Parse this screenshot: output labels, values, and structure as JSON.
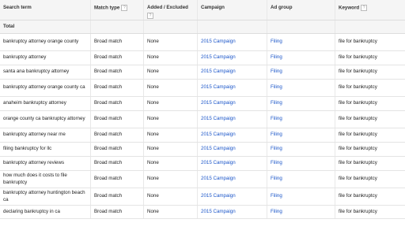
{
  "table": {
    "headers": {
      "search_term": "Search term",
      "match_type": "Match type",
      "added_excluded": "Added / Excluded",
      "campaign": "Campaign",
      "ad_group": "Ad group",
      "keyword": "Keyword"
    },
    "help_glyph": "?",
    "total_label": "Total",
    "rows": [
      {
        "search_term": "bankruptcy attorney orange county",
        "match_type": "Broad match",
        "added_excluded": "None",
        "campaign": "2015 Campaign",
        "ad_group": "Filing",
        "keyword": "file for bankruptcy"
      },
      {
        "search_term": "bankruptcy attorney",
        "match_type": "Broad match",
        "added_excluded": "None",
        "campaign": "2015 Campaign",
        "ad_group": "Filing",
        "keyword": "file for bankruptcy"
      },
      {
        "search_term": "santa ana bankruptcy attorney",
        "match_type": "Broad match",
        "added_excluded": "None",
        "campaign": "2015 Campaign",
        "ad_group": "Filing",
        "keyword": "file for bankruptcy"
      },
      {
        "search_term": "bankruptcy attorney orange county ca",
        "match_type": "Broad match",
        "added_excluded": "None",
        "campaign": "2015 Campaign",
        "ad_group": "Filing",
        "keyword": "file for bankruptcy"
      },
      {
        "search_term": "anaheim bankruptcy attorney",
        "match_type": "Broad match",
        "added_excluded": "None",
        "campaign": "2015 Campaign",
        "ad_group": "Filing",
        "keyword": "file for bankruptcy"
      },
      {
        "search_term": "orange county ca bankruptcy attorney",
        "match_type": "Broad match",
        "added_excluded": "None",
        "campaign": "2015 Campaign",
        "ad_group": "Filing",
        "keyword": "file for bankruptcy"
      },
      {
        "search_term": "bankruptcy attorney near me",
        "match_type": "Broad match",
        "added_excluded": "None",
        "campaign": "2015 Campaign",
        "ad_group": "Filing",
        "keyword": "file for bankruptcy"
      },
      {
        "search_term": "filing bankruptcy for llc",
        "match_type": "Broad match",
        "added_excluded": "None",
        "campaign": "2015 Campaign",
        "ad_group": "Filing",
        "keyword": "file for bankruptcy"
      },
      {
        "search_term": "bankruptcy attorney reviews",
        "match_type": "Broad match",
        "added_excluded": "None",
        "campaign": "2015 Campaign",
        "ad_group": "Filing",
        "keyword": "file for bankruptcy"
      },
      {
        "search_term": "how much does it costs to file bankruptcy",
        "match_type": "Broad match",
        "added_excluded": "None",
        "campaign": "2015 Campaign",
        "ad_group": "Filing",
        "keyword": "file for bankruptcy"
      },
      {
        "search_term": "bankruptcy attorney huntington beach ca",
        "match_type": "Broad match",
        "added_excluded": "None",
        "campaign": "2015 Campaign",
        "ad_group": "Filing",
        "keyword": "file for bankruptcy"
      },
      {
        "search_term": "declaring bankruptcy in ca",
        "match_type": "Broad match",
        "added_excluded": "None",
        "campaign": "2015 Campaign",
        "ad_group": "Filing",
        "keyword": "file for bankruptcy"
      }
    ]
  },
  "colors": {
    "link": "#1a55c9",
    "header_bg": "#f5f5f5"
  }
}
